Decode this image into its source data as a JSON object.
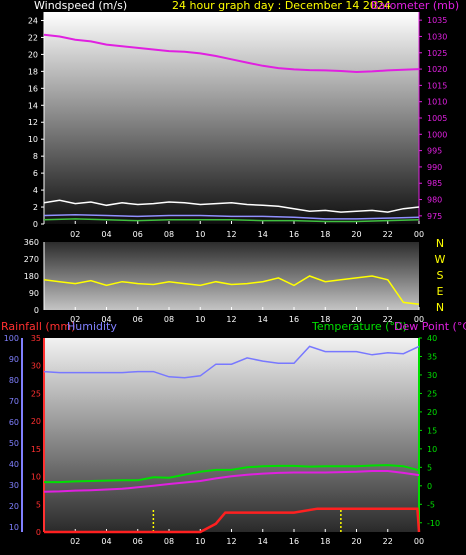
{
  "colors": {
    "background": "#000000",
    "wind_gust": "#ffffff",
    "wind_avg": "#9090ff",
    "wind_speed": "#40c040",
    "barometer": "#e020e0",
    "direction": "#ffff00",
    "rainfall": "#ff2020",
    "humidity": "#7878ff",
    "temperature": "#00e000",
    "dewpoint": "#e020e0",
    "header_yellow": "#ffff00",
    "axis_red": "#ff3030",
    "axis_blue": "#8080ff",
    "axis_green": "#00e000",
    "marker": "#ffff00"
  },
  "header": {
    "wind_label": "Windspeed (m/s)",
    "title": "24 hour graph day : December 14 2024",
    "baro_label": "Barometer (mb)",
    "rain_label": "Rainfall (mm)",
    "humidity_label": "Humidity",
    "temp_label": "Temperature (°C)",
    "dew_label": "Dew Point (°C)"
  },
  "chart_data": [
    {
      "type": "line",
      "name": "wind-barometer",
      "x_ticks": [
        "02",
        "04",
        "06",
        "08",
        "10",
        "12",
        "14",
        "16",
        "18",
        "20",
        "22",
        "00"
      ],
      "xlim": [
        0,
        24
      ],
      "y_left": {
        "label": "Windspeed (m/s)",
        "ticks": [
          0,
          2,
          4,
          6,
          8,
          10,
          12,
          14,
          16,
          18,
          20,
          22,
          24
        ],
        "ylim": [
          0,
          25
        ]
      },
      "y_right": {
        "label": "Barometer (mb)",
        "ticks": [
          975,
          980,
          985,
          990,
          995,
          1000,
          1005,
          1010,
          1015,
          1020,
          1025,
          1030,
          1035
        ],
        "ylim": [
          972.5,
          1037.5
        ]
      },
      "series": [
        {
          "key": "wind_gust",
          "axis": "left",
          "x": [
            0,
            1,
            2,
            3,
            4,
            5,
            6,
            7,
            8,
            9,
            10,
            11,
            12,
            13,
            14,
            15,
            16,
            17,
            18,
            19,
            20,
            21,
            22,
            23,
            24
          ],
          "y": [
            2.5,
            2.8,
            2.4,
            2.6,
            2.2,
            2.5,
            2.3,
            2.4,
            2.6,
            2.5,
            2.3,
            2.4,
            2.5,
            2.3,
            2.2,
            2.1,
            1.8,
            1.5,
            1.6,
            1.4,
            1.5,
            1.6,
            1.4,
            1.8,
            2.0
          ]
        },
        {
          "key": "wind_avg",
          "axis": "left",
          "x": [
            0,
            2,
            4,
            6,
            8,
            10,
            12,
            14,
            16,
            18,
            20,
            22,
            24
          ],
          "y": [
            1.0,
            1.1,
            1.0,
            0.9,
            1.0,
            1.0,
            0.9,
            0.9,
            0.8,
            0.6,
            0.6,
            0.7,
            0.8
          ]
        },
        {
          "key": "wind_speed",
          "axis": "left",
          "x": [
            0,
            2,
            4,
            6,
            8,
            10,
            12,
            14,
            16,
            18,
            20,
            22,
            24
          ],
          "y": [
            0.5,
            0.6,
            0.5,
            0.4,
            0.5,
            0.5,
            0.5,
            0.4,
            0.4,
            0.3,
            0.3,
            0.4,
            0.5
          ]
        },
        {
          "key": "barometer",
          "axis": "right",
          "x": [
            0,
            1,
            2,
            3,
            4,
            5,
            6,
            7,
            8,
            9,
            10,
            11,
            12,
            13,
            14,
            15,
            16,
            17,
            18,
            19,
            20,
            21,
            22,
            23,
            24
          ],
          "y": [
            1030.5,
            1030,
            1029,
            1028.5,
            1027.5,
            1027,
            1026.5,
            1026,
            1025.5,
            1025.3,
            1024.8,
            1024,
            1023,
            1022,
            1021,
            1020.3,
            1019.9,
            1019.7,
            1019.6,
            1019.4,
            1019.1,
            1019.3,
            1019.6,
            1019.8,
            1020
          ]
        }
      ]
    },
    {
      "type": "line",
      "name": "wind-direction",
      "x_ticks": [
        "02",
        "04",
        "06",
        "08",
        "10",
        "12",
        "14",
        "16",
        "18",
        "20",
        "22",
        "00"
      ],
      "xlim": [
        0,
        24
      ],
      "y_left": {
        "ticks": [
          0,
          90,
          180,
          270,
          360
        ],
        "ylim": [
          0,
          360
        ]
      },
      "y_right_labels": [
        "N",
        "W",
        "S",
        "E",
        "N"
      ],
      "series": [
        {
          "key": "direction",
          "x": [
            0,
            1,
            2,
            3,
            4,
            5,
            6,
            7,
            8,
            9,
            10,
            11,
            12,
            13,
            14,
            15,
            16,
            17,
            18,
            19,
            20,
            21,
            22,
            23,
            24
          ],
          "y": [
            160,
            150,
            140,
            155,
            130,
            150,
            140,
            135,
            150,
            140,
            130,
            150,
            135,
            140,
            150,
            170,
            130,
            180,
            150,
            160,
            170,
            180,
            160,
            40,
            30
          ]
        }
      ]
    },
    {
      "type": "line",
      "name": "rain-humidity-temperature",
      "x_ticks": [
        "02",
        "04",
        "06",
        "08",
        "10",
        "12",
        "14",
        "16",
        "18",
        "20",
        "22",
        "00"
      ],
      "xlim": [
        0,
        24
      ],
      "y_rain": {
        "label": "Rainfall (mm)",
        "ticks": [
          0,
          5,
          10,
          15,
          20,
          25,
          30,
          35
        ],
        "ylim": [
          0,
          35
        ]
      },
      "y_humidity": {
        "label": "Humidity",
        "ticks": [
          10,
          20,
          30,
          40,
          50,
          60,
          70,
          80,
          90,
          100
        ],
        "ylim": [
          7.5,
          100
        ]
      },
      "y_temp": {
        "label": "Temperature (°C)",
        "ticks": [
          -10,
          -5,
          0,
          5,
          10,
          15,
          20,
          25,
          30,
          35,
          40
        ],
        "ylim": [
          -12.5,
          40
        ]
      },
      "series": [
        {
          "key": "humidity",
          "x": [
            0,
            1,
            2,
            3,
            4,
            5,
            6,
            7,
            8,
            9,
            10,
            11,
            12,
            13,
            14,
            15,
            16,
            17,
            18,
            19,
            20,
            21,
            22,
            23,
            24
          ],
          "y": [
            84,
            83.5,
            83.5,
            83.5,
            83.5,
            83.5,
            84,
            84,
            81.5,
            81,
            82,
            87.5,
            87.5,
            90.5,
            89,
            88,
            88,
            96,
            93.5,
            93.5,
            93.5,
            92,
            93,
            92.5,
            96
          ]
        },
        {
          "key": "temperature",
          "x": [
            0,
            1,
            2,
            3,
            4,
            5,
            6,
            7,
            8,
            9,
            10,
            11,
            12,
            13,
            14,
            15,
            16,
            17,
            18,
            19,
            20,
            21,
            22,
            23,
            24
          ],
          "y": [
            1,
            1,
            1.2,
            1.3,
            1.4,
            1.5,
            1.5,
            2.3,
            2.2,
            3,
            3.8,
            4.3,
            4.3,
            5,
            5.3,
            5.4,
            5.4,
            5.2,
            5.3,
            5.3,
            5.3,
            5.5,
            5.6,
            5.3,
            4.2
          ]
        },
        {
          "key": "dewpoint",
          "x": [
            0,
            1,
            2,
            3,
            4,
            5,
            6,
            7,
            8,
            9,
            10,
            11,
            12,
            13,
            14,
            15,
            16,
            17,
            18,
            19,
            20,
            21,
            22,
            23,
            24
          ],
          "y": [
            -1.6,
            -1.5,
            -1.3,
            -1.2,
            -1,
            -0.8,
            -0.4,
            0,
            0.5,
            0.9,
            1.3,
            2,
            2.6,
            3,
            3.3,
            3.5,
            3.6,
            3.6,
            3.6,
            3.7,
            3.8,
            4,
            4,
            3.5,
            2.9
          ]
        },
        {
          "key": "rainfall",
          "x": [
            0,
            1,
            2,
            3,
            4,
            5,
            6,
            7,
            8,
            9,
            10,
            11,
            11.6,
            12,
            14,
            16,
            17.5,
            20,
            22,
            23.9,
            24
          ],
          "y": [
            0,
            0,
            0,
            0,
            0,
            0,
            0,
            0,
            0,
            0,
            0,
            1.5,
            3.5,
            3.5,
            3.5,
            3.5,
            4.2,
            4.2,
            4.2,
            4.2,
            0
          ]
        }
      ],
      "markers_x": [
        7,
        19
      ]
    }
  ]
}
